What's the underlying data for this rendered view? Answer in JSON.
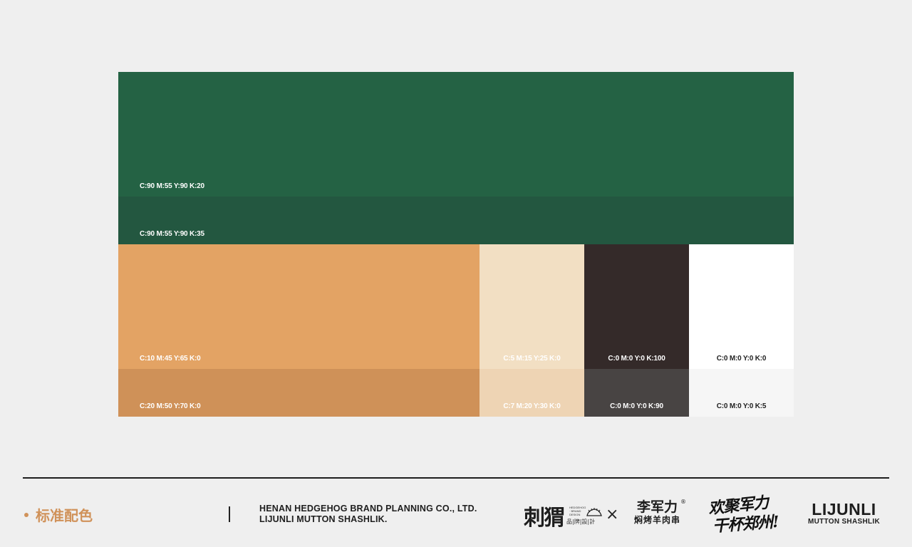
{
  "colors": {
    "green_k20": "#246244",
    "green_k35": "#235740",
    "orange": "#e3a364",
    "orange_dark": "#cf9158",
    "cream": "#f2dfc3",
    "cream_dark": "#eed4b4",
    "brown_black": "#342a29",
    "dark_gray": "#484443",
    "white": "#ffffff",
    "off_white": "#f6f6f6",
    "accent": "#d0925a"
  },
  "swatches": [
    {
      "id": "green-k20",
      "label": "C:90 M:55 Y:90 K:20",
      "color": "#246244",
      "text_color": "#ffffff"
    },
    {
      "id": "green-k35",
      "label": "C:90 M:55 Y:90 K:35",
      "color": "#235740",
      "text_color": "#ffffff"
    },
    {
      "id": "orange-main",
      "label": "C:10 M:45 Y:65 K:0",
      "color": "#e3a364",
      "text_color": "#ffffff"
    },
    {
      "id": "orange-dark",
      "label": "C:20 M:50 Y:70 K:0",
      "color": "#cf9158",
      "text_color": "#ffffff"
    },
    {
      "id": "cream-main",
      "label": "C:5 M:15 Y:25 K:0",
      "color": "#f2dfc3",
      "text_color": "#ffffff"
    },
    {
      "id": "cream-dark",
      "label": "C:7 M:20 Y:30 K:0",
      "color": "#eed4b4",
      "text_color": "#ffffff"
    },
    {
      "id": "black-main",
      "label": "C:0 M:0 Y:0 K:100",
      "color": "#342a29",
      "text_color": "#ffffff"
    },
    {
      "id": "black-90",
      "label": "C:0 M:0 Y:0 K:90",
      "color": "#484443",
      "text_color": "#ffffff"
    },
    {
      "id": "white-main",
      "label": "C:0 M:0 Y:0 K:0",
      "color": "#ffffff",
      "text_color": "#222222"
    },
    {
      "id": "white-5",
      "label": "C:0 M:0 Y:0 K:5",
      "color": "#f6f6f6",
      "text_color": "#222222"
    }
  ],
  "footer": {
    "section_title": "标准配色",
    "company_line1": "HENAN HEDGEHOG BRAND PLANNING CO., LTD.",
    "company_line2": "LIJUNLI MUTTON SHASHLIK.",
    "ciwei_logo_cn": "刺猬",
    "ciwei_logo_en": "HEDGEHOG · BRAND DESIGN",
    "ciwei_logo_sub": "品|牌|設|計",
    "cross": "×",
    "ljl_cn_big": "李军力",
    "ljl_cn_small": "焖烤羊肉串",
    "registered": "®",
    "slogan_line1": "欢聚军力",
    "slogan_line2": "干杯郑州!",
    "wordmark_line1": "LIJUNLI",
    "wordmark_line2": "MUTTON SHASHLIK"
  }
}
